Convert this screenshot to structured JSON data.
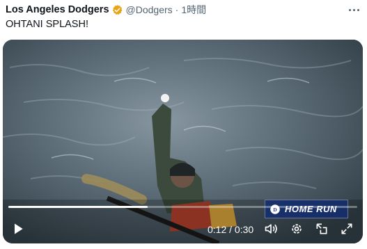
{
  "tweet": {
    "author_name": "Los Angeles Dodgers",
    "handle": "@Dodgers",
    "separator": "·",
    "time": "1時間",
    "text": "OHTANI SPLASH!"
  },
  "video": {
    "overlay_badge": "HOME RUN",
    "current_time": "0:12",
    "duration": "0:30",
    "time_display": "0:12 / 0:30",
    "progress_fraction": 0.4
  },
  "colors": {
    "verified_badge": "#e8a317",
    "badge_background": "#1d3a8a",
    "secondary_text": "#536471"
  },
  "icons": [
    "verified-badge-icon",
    "more-icon",
    "play-icon",
    "volume-icon",
    "settings-icon",
    "pip-icon",
    "fullscreen-icon",
    "dodgers-logo"
  ]
}
